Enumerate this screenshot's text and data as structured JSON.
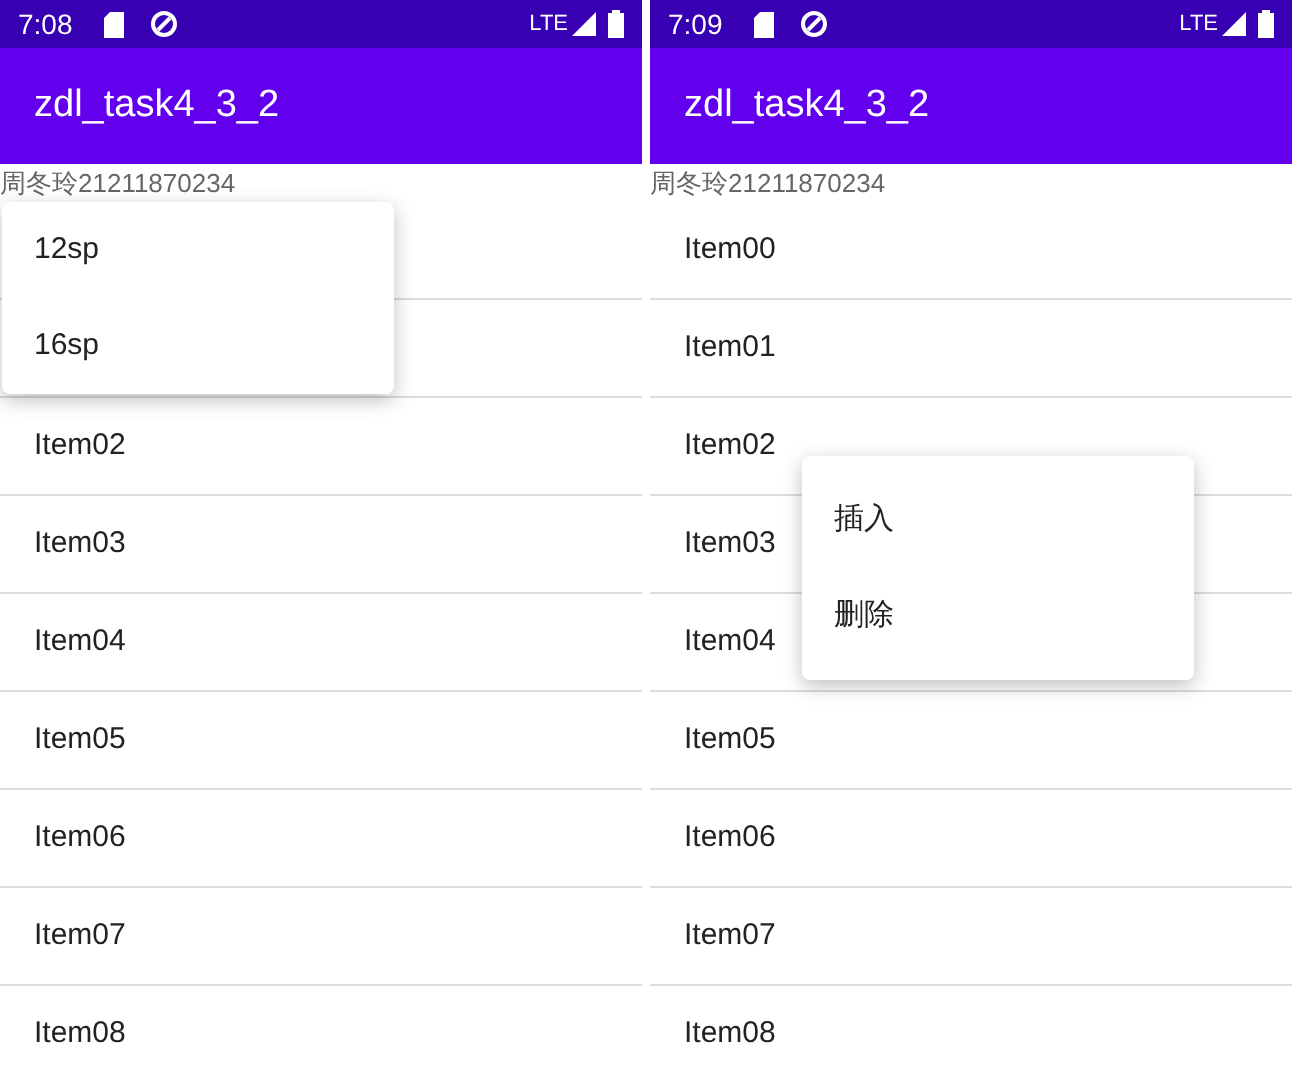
{
  "screens": [
    {
      "status_bar": {
        "time": "7:08",
        "network": "LTE"
      },
      "app_bar": {
        "title": "zdl_task4_3_2"
      },
      "subtitle": "周冬玲21211870234",
      "list": [
        {
          "label": "Item02"
        },
        {
          "label": "Item03"
        },
        {
          "label": "Item04"
        },
        {
          "label": "Item05"
        },
        {
          "label": "Item06"
        },
        {
          "label": "Item07"
        },
        {
          "label": "Item08"
        }
      ],
      "popup_menu": {
        "kind": "options",
        "items": [
          "12sp",
          "16sp"
        ]
      }
    },
    {
      "status_bar": {
        "time": "7:09",
        "network": "LTE"
      },
      "app_bar": {
        "title": "zdl_task4_3_2"
      },
      "subtitle": "周冬玲21211870234",
      "list": [
        {
          "label": "Item00"
        },
        {
          "label": "Item01"
        },
        {
          "label": "Item02"
        },
        {
          "label": "Item03"
        },
        {
          "label": "Item04"
        },
        {
          "label": "Item05"
        },
        {
          "label": "Item06"
        },
        {
          "label": "Item07"
        },
        {
          "label": "Item08"
        }
      ],
      "popup_menu": {
        "kind": "context",
        "items": [
          "插入",
          "删除"
        ]
      }
    }
  ]
}
